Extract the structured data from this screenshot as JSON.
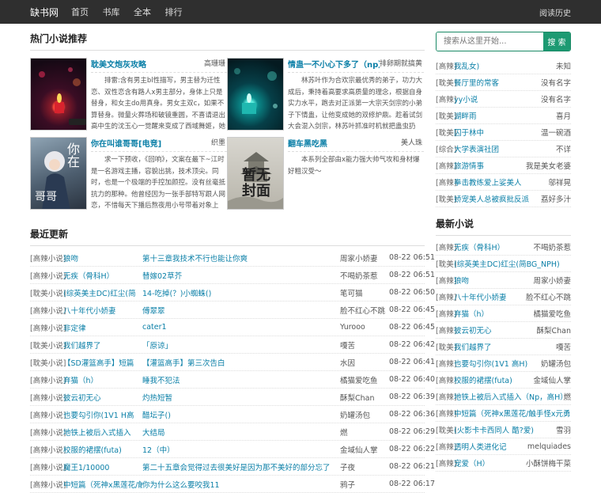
{
  "header": {
    "logo": "缺书网",
    "nav": [
      "首页",
      "书库",
      "全本",
      "排行"
    ],
    "history": "阅读历史"
  },
  "search": {
    "placeholder": "搜索从这里开始...",
    "button": "搜 索"
  },
  "hot": {
    "title": "热门小说推荐",
    "books": [
      {
        "title": "耽美文炮灰攻略",
        "author": "高珊珊",
        "desc": "排雷:含有男主bl性描写，男主替为迁性恋、双性恋含有路人x男主部分，身体上只是替身，和女主do用真身。男女主双c，如果不算替身。微量火葬场和破镜重圆，不喜请退出高中生的沈玉心一觉醒来变成了西域舞姬，她"
      },
      {
        "title": "情蛊一不小心下多了（np）",
        "author": "排卵期就搞黄",
        "desc": "林苏叶作为合欢宗最优秀的弟子，功力大成后，秉持着高要求高质量的理念，根据自身实力水平，跑去对正派第一大宗天剑宗的小弟子下情蛊，让他变成她的双修炉鼎。趁着试剑大会混入剑宗，林苏叶抓准时机就把蛊虫扔"
      },
      {
        "title": "你在叫谁哥哥[电竞]",
        "author": "织墨",
        "desc": "求一下预收，《回响》，文案在最下~江时是一名游戏主播，容貌出挑，技术顶尖。同时，也是一个极端的手控加颜控。没有丝毫抵抗力的那种。他曾经因为一张手部特写跟人网恋，不惜每天下播后熬夜用小号带着对象上"
      },
      {
        "title": "翻车黑吃黑",
        "author": "美人珠",
        "desc": "本系列全部由x能力强大帅气攻和身材爆好粗汉受～"
      }
    ]
  },
  "recent": {
    "title": "最近更新",
    "rows": [
      {
        "cat": "[高辣小说]",
        "name": "狼吻",
        "chapter": "第十三章我技术不行也能让你爽",
        "author": "周家小娇妻",
        "time": "08-22 06:51"
      },
      {
        "cat": "[高辣小说]",
        "name": "无疾（骨科H）",
        "chapter": "替嫁02草芥",
        "author": "不喝奶茶惹",
        "time": "08-22 06:51"
      },
      {
        "cat": "[耽美小说]",
        "name": "(综英美主DC)红尘(简",
        "chapter": "14-吃掉(？)小蜘蛛()",
        "author": "笔可猫",
        "time": "08-22 06:50"
      },
      {
        "cat": "[高辣小说]",
        "name": "八十年代小娇妻",
        "chapter": "傅翠翠",
        "author": "脸不红心不跳",
        "time": "08-22 06:45"
      },
      {
        "cat": "[高辣小说]",
        "name": "非定律",
        "chapter": "cater1",
        "author": "Yurooo",
        "time": "08-22 06:45"
      },
      {
        "cat": "[耽美小说]",
        "name": "我们越界了",
        "chapter": "「原谅」",
        "author": "嘎苦",
        "time": "08-22 06:42"
      },
      {
        "cat": "[耽美小说]",
        "name": "【SD灌篮高手】短篇",
        "chapter": "【灌篮高手】第三次告白",
        "author": "水因",
        "time": "08-22 06:41"
      },
      {
        "cat": "[高辣小说]",
        "name": "弃猫（h）",
        "chapter": "睡我不犯法",
        "author": "橘猫爱吃鱼",
        "time": "08-22 06:40"
      },
      {
        "cat": "[高辣小说]",
        "name": "彼云初无心",
        "chapter": "灼热短暂",
        "author": "酥梨Chan",
        "time": "08-22 06:39"
      },
      {
        "cat": "[高辣小说]",
        "name": "也要勾引你(1V1 H高",
        "chapter": "醋坛子()",
        "author": "奶罐汤包",
        "time": "08-22 06:36"
      },
      {
        "cat": "[高辣小说]",
        "name": "地铁上被后入式插入",
        "chapter": "大结局",
        "author": "燃",
        "time": "08-22 06:29"
      },
      {
        "cat": "[高辣小说]",
        "name": "校服的裙摆(futa)",
        "chapter": "12（中）",
        "author": "金域仙人掌",
        "time": "08-22 06:22"
      },
      {
        "cat": "[高辣小说]",
        "name": "魔王1/10000",
        "chapter": "第二十五章会觉得过去很美好是因为那不美好的部分忘了",
        "author": "子夜",
        "time": "08-22 06:21"
      },
      {
        "cat": "[高辣小说]",
        "name": "中短篇（死神x黑莲花/触",
        "chapter": "你为什么这么要咬我11",
        "author": "鸦子",
        "time": "08-22 06:17"
      }
    ]
  },
  "side_list": [
    {
      "cat": "[高辣]",
      "name": "我乱女)",
      "author": "未知"
    },
    {
      "cat": "[耽美]",
      "name": "餐厅里的常客",
      "author": "没有名字"
    },
    {
      "cat": "[高辣]",
      "name": "yy小说",
      "author": "没有名字"
    },
    {
      "cat": "[耽美]",
      "name": "湖畔雨",
      "author": "喜月"
    },
    {
      "cat": "[耽美]",
      "name": "囚于林中",
      "author": "温一碗酒"
    },
    {
      "cat": "[综合]",
      "name": "大学表演社团",
      "author": "不详"
    },
    {
      "cat": "[高辣]",
      "name": "旅游情事",
      "author": "我是美女老婆"
    },
    {
      "cat": "[高辣]",
      "name": "拳击教练爱上娑美人",
      "author": "邬祥晃"
    },
    {
      "cat": "[耽美]",
      "name": "娇宠美人总被疯批反派",
      "author": "荔好多汁"
    }
  ],
  "newest": {
    "title": "最新小说",
    "rows": [
      {
        "cat": "[高辣]",
        "name": "无疾（骨科H）",
        "author": "不喝奶茶惹"
      },
      {
        "cat": "[耽美]",
        "name": "(综英美主DC)红尘(简BG_NPH)",
        "author": ""
      },
      {
        "cat": "[高辣]",
        "name": "狼吻",
        "author": "周家小娇妻"
      },
      {
        "cat": "[高辣]",
        "name": "八十年代小娇妻",
        "author": "脸不红心不跳"
      },
      {
        "cat": "[高辣]",
        "name": "弃猫（h）",
        "author": "橘猫爱吃鱼"
      },
      {
        "cat": "[高辣]",
        "name": "彼云初无心",
        "author": "酥梨Chan"
      },
      {
        "cat": "[耽美]",
        "name": "我们越界了",
        "author": "嘎苦"
      },
      {
        "cat": "[高辣]",
        "name": "也要勾引你(1V1 高H)",
        "author": "奶罐汤包"
      },
      {
        "cat": "[高辣]",
        "name": "校服的裙摆(futa)",
        "author": "金域仙人掌"
      },
      {
        "cat": "[高辣]",
        "name": "地铁上被后入式插入（Np，高H）",
        "author": "燃"
      },
      {
        "cat": "[高辣]",
        "name": "中短篇（死神x黑莲花/触手怪x元勇",
        "author": ""
      },
      {
        "cat": "[耽美]",
        "name": "(火影卡卡西同人 酷?爱)",
        "author": "雪羽"
      },
      {
        "cat": "[高辣]",
        "name": "透明人类进化记",
        "author": "melquiades"
      },
      {
        "cat": "[高辣]",
        "name": "宠爱（H）",
        "author": "小酥饼梅干菜"
      }
    ]
  }
}
